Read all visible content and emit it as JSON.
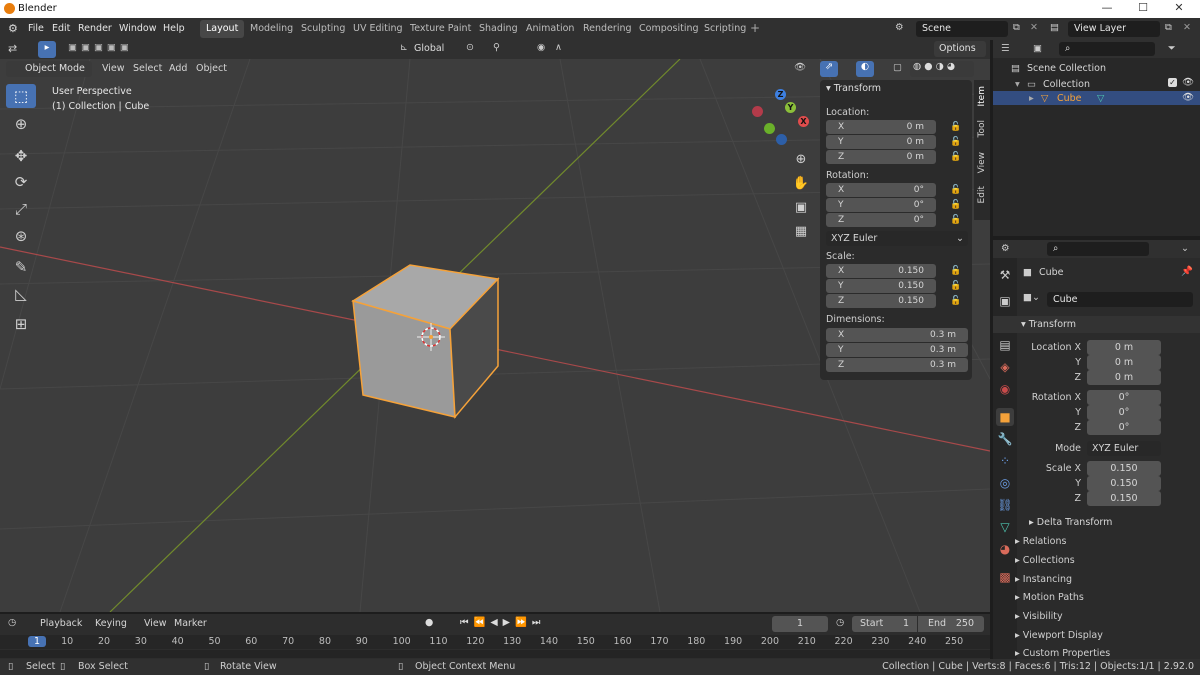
{
  "window": {
    "title": "Blender"
  },
  "menu": [
    "File",
    "Edit",
    "Render",
    "Window",
    "Help"
  ],
  "workspaces": [
    "Layout",
    "Modeling",
    "Sculpting",
    "UV Editing",
    "Texture Paint",
    "Shading",
    "Animation",
    "Rendering",
    "Compositing",
    "Scripting"
  ],
  "active_workspace": "Layout",
  "scene": "Scene",
  "view_layer": "View Layer",
  "tool_header": {
    "orientation": "Global",
    "options": "Options"
  },
  "viewport_header": {
    "mode": "Object Mode",
    "menus": [
      "View",
      "Select",
      "Add",
      "Object"
    ]
  },
  "viewport_info": {
    "line1": "User Perspective",
    "line2": "(1) Collection | Cube"
  },
  "gizmo": {
    "x": "X",
    "y": "Y",
    "z": "Z"
  },
  "npanel": {
    "header": "Transform",
    "location_label": "Location:",
    "location": [
      {
        "k": "X",
        "v": "0 m"
      },
      {
        "k": "Y",
        "v": "0 m"
      },
      {
        "k": "Z",
        "v": "0 m"
      }
    ],
    "rotation_label": "Rotation:",
    "rotation": [
      {
        "k": "X",
        "v": "0°"
      },
      {
        "k": "Y",
        "v": "0°"
      },
      {
        "k": "Z",
        "v": "0°"
      }
    ],
    "rotation_mode": "XYZ Euler",
    "scale_label": "Scale:",
    "scale": [
      {
        "k": "X",
        "v": "0.150"
      },
      {
        "k": "Y",
        "v": "0.150"
      },
      {
        "k": "Z",
        "v": "0.150"
      }
    ],
    "dimensions_label": "Dimensions:",
    "dimensions": [
      {
        "k": "X",
        "v": "0.3 m"
      },
      {
        "k": "Y",
        "v": "0.3 m"
      },
      {
        "k": "Z",
        "v": "0.3 m"
      }
    ],
    "tabs": [
      "Item",
      "Tool",
      "View",
      "Edit"
    ]
  },
  "outliner": {
    "root": "Scene Collection",
    "collection": "Collection",
    "object": "Cube"
  },
  "properties": {
    "object_name": "Cube",
    "data_name": "Cube",
    "section": "Transform",
    "loc_label": "Location X",
    "loc": [
      "0 m",
      "0 m",
      "0 m"
    ],
    "rot_label": "Rotation X",
    "rot": [
      "0°",
      "0°",
      "0°"
    ],
    "mode_label": "Mode",
    "mode": "XYZ Euler",
    "scale_label": "Scale X",
    "scale": [
      "0.150",
      "0.150",
      "0.150"
    ],
    "axis_y": "Y",
    "axis_z": "Z",
    "delta": "Delta Transform",
    "panels": [
      "Relations",
      "Collections",
      "Instancing",
      "Motion Paths",
      "Visibility",
      "Viewport Display",
      "Custom Properties"
    ]
  },
  "timeline": {
    "menus": [
      "Playback",
      "Keying",
      "View",
      "Marker"
    ],
    "current_frame": "1",
    "start_label": "Start",
    "start": "1",
    "end_label": "End",
    "end": "250",
    "frame_labels": [
      "1",
      "10",
      "20",
      "30",
      "40",
      "50",
      "60",
      "70",
      "80",
      "90",
      "100",
      "110",
      "120",
      "130",
      "140",
      "150",
      "160",
      "170",
      "180",
      "190",
      "200",
      "210",
      "220",
      "230",
      "240",
      "250"
    ]
  },
  "status": {
    "select": "Select",
    "box_select": "Box Select",
    "rotate": "Rotate View",
    "context": "Object Context Menu",
    "info": "Collection | Cube | Verts:8 | Faces:6 | Tris:12 | Objects:1/1 | 2.92.0"
  },
  "colors": {
    "accent": "#4772b3",
    "selected_outline": "#f5a23a",
    "x_axis": "#c24141",
    "y_axis": "#7e9b2c"
  }
}
